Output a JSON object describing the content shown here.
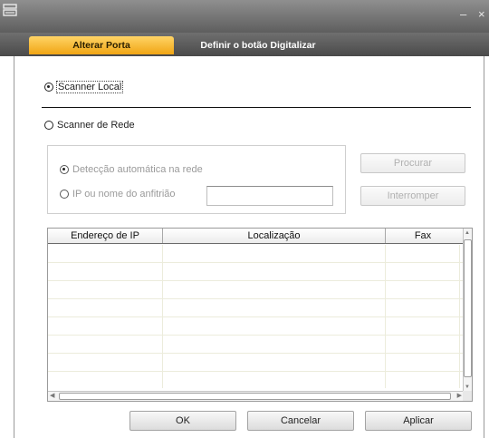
{
  "window": {
    "minimize_glyph": "–",
    "close_glyph": "×",
    "app_icon": "scanner-icon"
  },
  "tabs": [
    {
      "label": "Alterar Porta",
      "active": true
    },
    {
      "label": "Definir o botão Digitalizar",
      "active": false
    }
  ],
  "options": {
    "local_label": "Scanner Local",
    "local_selected": true,
    "network_label": "Scanner de Rede",
    "network_selected": false
  },
  "network": {
    "auto_detect_label": "Detecção automática na rede",
    "auto_detect_selected": true,
    "ip_label": "IP ou nome do anfitrião",
    "ip_selected": false,
    "ip_value": "",
    "search_button": "Procurar",
    "stop_button": "Interromper"
  },
  "table": {
    "columns": [
      "Endereço de IP",
      "Localização",
      "Fax"
    ],
    "rows": []
  },
  "footer": {
    "ok": "OK",
    "cancel": "Cancelar",
    "apply": "Aplicar"
  },
  "colors": {
    "active_tab": "#f0a514",
    "titlebar": "#6e6e6e"
  }
}
